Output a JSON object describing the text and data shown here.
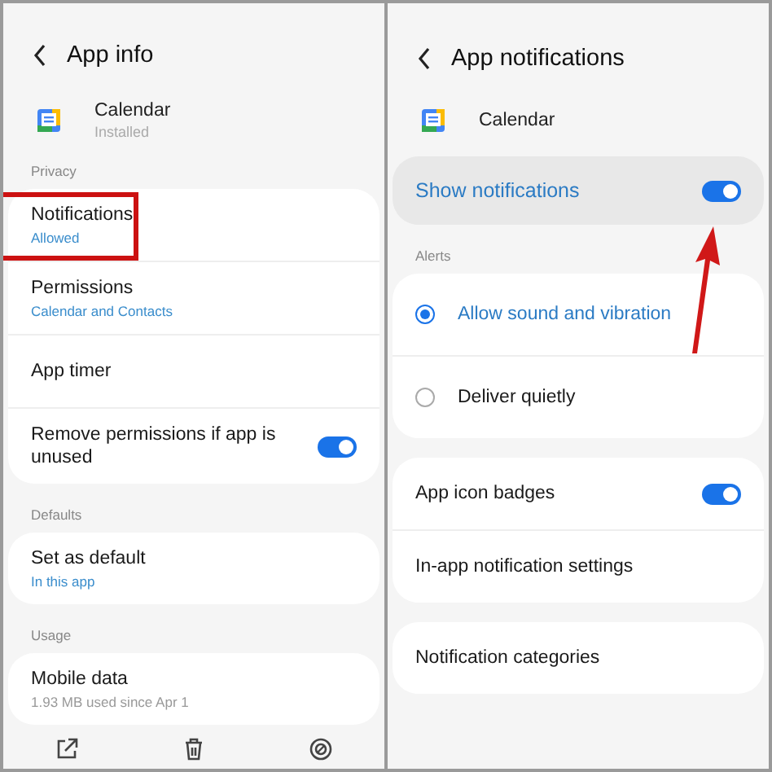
{
  "left": {
    "title": "App info",
    "app": {
      "name": "Calendar",
      "status": "Installed"
    },
    "sections": [
      {
        "header": "Privacy",
        "items": [
          {
            "kind": "value",
            "title": "Notifications",
            "subtitle": "Allowed",
            "highlighted": true
          },
          {
            "kind": "value",
            "title": "Permissions",
            "subtitle": "Calendar and Contacts",
            "highlighted": false
          },
          {
            "kind": "plain",
            "title": "App timer",
            "highlighted": false
          },
          {
            "kind": "toggle",
            "title": "Remove permissions if app is unused",
            "on": true,
            "highlighted": false
          }
        ]
      },
      {
        "header": "Defaults",
        "items": [
          {
            "kind": "value",
            "title": "Set as default",
            "subtitle": "In this app",
            "highlighted": false
          }
        ]
      },
      {
        "header": "Usage",
        "items": [
          {
            "kind": "info",
            "title": "Mobile data",
            "subtitle": "1.93 MB used since Apr 1",
            "highlighted": false
          }
        ]
      }
    ],
    "bottom_bar": [
      {
        "kind": "open"
      },
      {
        "kind": "uninstall"
      },
      {
        "kind": "stop"
      }
    ]
  },
  "right": {
    "title": "App notifications",
    "app": {
      "name": "Calendar"
    },
    "master": {
      "label": "Show notifications",
      "on": true
    },
    "alerts": {
      "header": "Alerts",
      "options": [
        {
          "label": "Allow sound and vibration",
          "selected": true
        },
        {
          "label": "Deliver quietly",
          "selected": false
        }
      ]
    },
    "groups": [
      [
        {
          "kind": "toggle",
          "label": "App icon badges",
          "on": true
        },
        {
          "kind": "plain",
          "label": "In-app notification settings"
        }
      ],
      [
        {
          "kind": "plain",
          "label": "Notification categories"
        }
      ]
    ]
  }
}
